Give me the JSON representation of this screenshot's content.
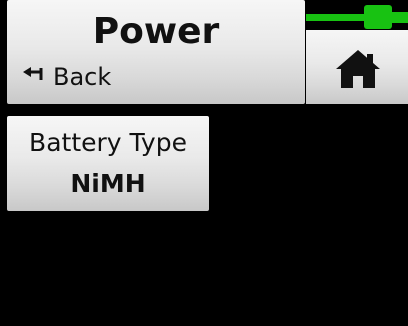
{
  "header": {
    "title": "Power",
    "back_label": "Back",
    "back_icon": "return-arrow-icon"
  },
  "status": {
    "battery_icon": "battery-icon",
    "battery_color": "#18c212",
    "home_icon": "home-icon"
  },
  "tiles": [
    {
      "label": "Battery Type",
      "value": "NiMH"
    }
  ],
  "colors": {
    "background": "#000000",
    "panel": "#e6e6e6",
    "text": "#111111"
  }
}
